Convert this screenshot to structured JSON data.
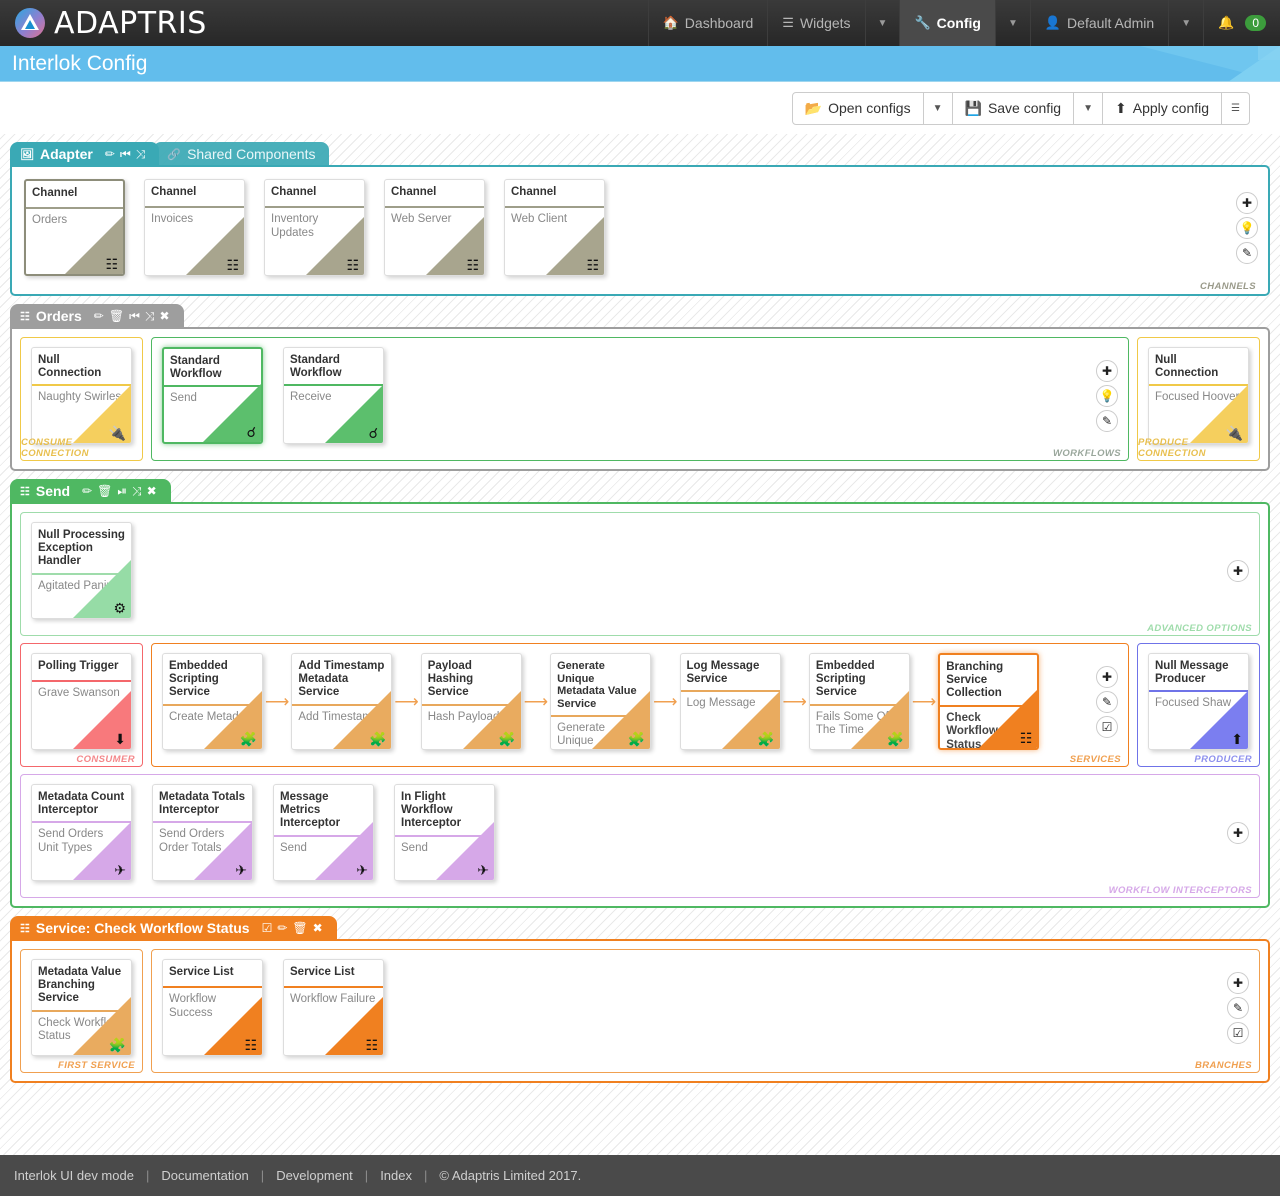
{
  "navbar": {
    "brand": "ADAPTRIS",
    "items": [
      {
        "label": "Dashboard",
        "icon": "home-icon"
      },
      {
        "label": "Widgets",
        "icon": "list-icon"
      },
      {
        "label": "Config",
        "icon": "wrench-icon"
      },
      {
        "label": "Default Admin",
        "icon": "user-icon"
      }
    ],
    "notifications": "0"
  },
  "page": {
    "title": "Interlok Config"
  },
  "toolbar": {
    "open_configs": "Open configs",
    "save_config": "Save config",
    "apply_config": "Apply config",
    "menu_icon": "hamburger-icon"
  },
  "adapter_panel": {
    "tabs": [
      {
        "label": "Adapter",
        "icon": "adapter-icon",
        "active": true,
        "actions": [
          "edit-icon",
          "minimise-icon",
          "collapse-icon"
        ]
      },
      {
        "label": "Shared Components",
        "icon": "share-icon",
        "active": false,
        "actions": []
      }
    ],
    "group_label": "CHANNELS",
    "side_buttons": [
      "add-icon",
      "bulb-icon",
      "edit-icon"
    ],
    "cards": [
      {
        "title": "Channel",
        "sub": "Orders",
        "glyph": "sitemap-icon",
        "selected": true
      },
      {
        "title": "Channel",
        "sub": "Invoices",
        "glyph": "sitemap-icon",
        "selected": false
      },
      {
        "title": "Channel",
        "sub": "Inventory Updates",
        "glyph": "sitemap-icon",
        "selected": false
      },
      {
        "title": "Channel",
        "sub": "Web Server",
        "glyph": "sitemap-icon",
        "selected": false
      },
      {
        "title": "Channel",
        "sub": "Web Client",
        "glyph": "sitemap-icon",
        "selected": false
      }
    ]
  },
  "orders_panel": {
    "tab": {
      "label": "Orders",
      "icon": "sitemap-icon",
      "actions": [
        "edit-icon",
        "delete-icon",
        "minimise-icon",
        "collapse-icon",
        "close-icon"
      ]
    },
    "consume_connection": {
      "group_label": "CONSUME CONNECTION",
      "card": {
        "title": "Null Connection",
        "sub": "Naughty Swirles",
        "glyph": "plug-icon"
      }
    },
    "workflows": {
      "group_label": "WORKFLOWS",
      "side_buttons": [
        "add-icon",
        "bulb-icon",
        "edit-icon"
      ],
      "cards": [
        {
          "title": "Standard Workflow",
          "sub": "Send",
          "glyph": "chain-icon",
          "selected": true
        },
        {
          "title": "Standard Workflow",
          "sub": "Receive",
          "glyph": "chain-icon",
          "selected": false
        }
      ]
    },
    "produce_connection": {
      "group_label": "PRODUCE CONNECTION",
      "card": {
        "title": "Null Connection",
        "sub": "Focused Hoover",
        "glyph": "plug-icon"
      }
    }
  },
  "send_panel": {
    "tab": {
      "label": "Send",
      "icon": "workflow-icon",
      "actions": [
        "edit-icon",
        "delete-icon",
        "minimise-icon",
        "collapse-icon",
        "close-icon"
      ]
    },
    "advanced_options": {
      "group_label": "ADVANCED OPTIONS",
      "side_buttons": [
        "add-icon"
      ],
      "cards": [
        {
          "title": "Null Processing Exception Handler",
          "sub": "Agitated Panini",
          "glyph": "gear-icon"
        }
      ]
    },
    "consumer": {
      "group_label": "CONSUMER",
      "card": {
        "title": "Polling Trigger",
        "sub": "Grave Swanson",
        "glyph": "download-icon"
      }
    },
    "services": {
      "group_label": "SERVICES",
      "side_buttons": [
        "add-icon",
        "edit-icon",
        "check-icon"
      ],
      "cards": [
        {
          "title": "Embedded Scripting Service",
          "sub": "Create Metadata",
          "glyph": "puzzle-icon",
          "selected": false
        },
        {
          "title": "Add Timestamp Metadata Service",
          "sub": "Add Timestamp",
          "glyph": "puzzle-icon",
          "selected": false
        },
        {
          "title": "Payload Hashing Service",
          "sub": "Hash Payload",
          "glyph": "puzzle-icon",
          "selected": false
        },
        {
          "title": "Generate Unique Metadata Value Service",
          "sub": "Generate Unique Metadata",
          "glyph": "puzzle-icon",
          "selected": false
        },
        {
          "title": "Log Message Service",
          "sub": "Log Message",
          "glyph": "puzzle-icon",
          "selected": false
        },
        {
          "title": "Embedded Scripting Service",
          "sub": "Fails Some Of The Time",
          "glyph": "puzzle-icon",
          "selected": false
        },
        {
          "title": "Branching Service Collection",
          "sub": "Check Workflow Status",
          "glyph": "branch-icon",
          "selected": true
        }
      ]
    },
    "producer": {
      "group_label": "PRODUCER",
      "card": {
        "title": "Null Message Producer",
        "sub": "Focused Shaw",
        "glyph": "upload-icon"
      }
    },
    "interceptors": {
      "group_label": "WORKFLOW INTERCEPTORS",
      "side_buttons": [
        "add-icon"
      ],
      "cards": [
        {
          "title": "Metadata Count Interceptor",
          "sub": "Send Orders Unit Types",
          "glyph": "plane-icon"
        },
        {
          "title": "Metadata Totals Interceptor",
          "sub": "Send Orders Order Totals",
          "glyph": "plane-icon"
        },
        {
          "title": "Message Metrics Interceptor",
          "sub": "Send",
          "glyph": "plane-icon"
        },
        {
          "title": "In Flight Workflow Interceptor",
          "sub": "Send",
          "glyph": "plane-icon"
        }
      ]
    }
  },
  "service_panel": {
    "tab": {
      "label": "Service: Check Workflow Status",
      "icon": "branch-icon",
      "actions": [
        "check-icon",
        "edit-icon",
        "delete-icon",
        "close-icon"
      ]
    },
    "first_service": {
      "group_label": "FIRST SERVICE",
      "card": {
        "title": "Metadata Value Branching Service",
        "sub": "Check Workflow Status",
        "glyph": "puzzle-icon"
      }
    },
    "branches": {
      "group_label": "BRANCHES",
      "side_buttons": [
        "add-icon",
        "edit-icon",
        "check-icon"
      ],
      "cards": [
        {
          "title": "Service List",
          "sub": "Workflow Success",
          "glyph": "branch-icon"
        },
        {
          "title": "Service List",
          "sub": "Workflow Failure",
          "glyph": "branch-icon"
        }
      ]
    }
  },
  "footer": {
    "app": "Interlok UI  dev mode",
    "links": [
      "Documentation",
      "Development",
      "Index"
    ],
    "copyright": "© Adaptris Limited 2017."
  },
  "colors": {
    "teal": "#3aa9b5",
    "gray": "#9e9e9e",
    "green": "#4fb862",
    "orange": "#f08020",
    "yellow": "#f5c945",
    "red": "#f4676b",
    "blue": "#6f73e8",
    "purple": "#d6a8e8",
    "accent_blue": "#62bdec"
  }
}
